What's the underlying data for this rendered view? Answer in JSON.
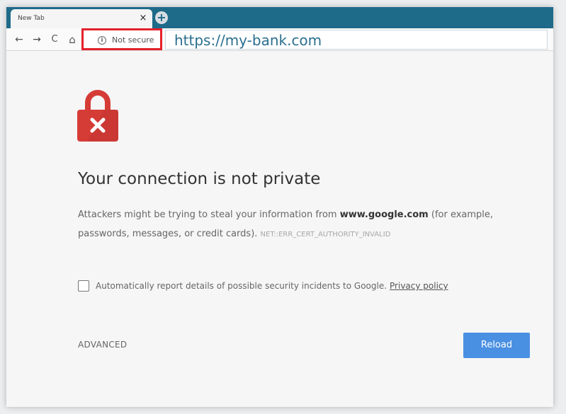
{
  "tab": {
    "title": "New Tab",
    "close_glyph": "×",
    "new_tab_glyph": "+"
  },
  "toolbar": {
    "back_icon": "←",
    "forward_icon": "→",
    "reload_icon": "C",
    "home_icon": "⌂",
    "security_icon": "i",
    "security_label": "Not secure",
    "url": "https://my-bank.com"
  },
  "page": {
    "headline": "Your connection is not private",
    "body_prefix": "Attackers might be trying to steal your information from ",
    "body_domain": "www.google.com",
    "body_suffix": " (for example, passwords, messages, or credit cards).",
    "error_code": "NET::ERR_CERT_AUTHORITY_INVALID",
    "checkbox_label": "Automatically report details of possible security incidents to Google.",
    "privacy_link": "Privacy policy",
    "advanced_label": "ADVANCED",
    "reload_label": "Reload"
  },
  "colors": {
    "tabstrip": "#1e6a89",
    "lock_red": "#d63c36",
    "highlight_box": "#e3222a",
    "reload_button": "#4a90e2",
    "url_text": "#2a6f8f"
  },
  "icons": {
    "lock": "lock-error-icon",
    "info": "info-icon",
    "back": "back-arrow-icon",
    "forward": "forward-arrow-icon",
    "reload": "reload-icon",
    "home": "home-icon",
    "close": "close-icon",
    "new_tab": "plus-icon"
  },
  "checkbox_checked": false
}
